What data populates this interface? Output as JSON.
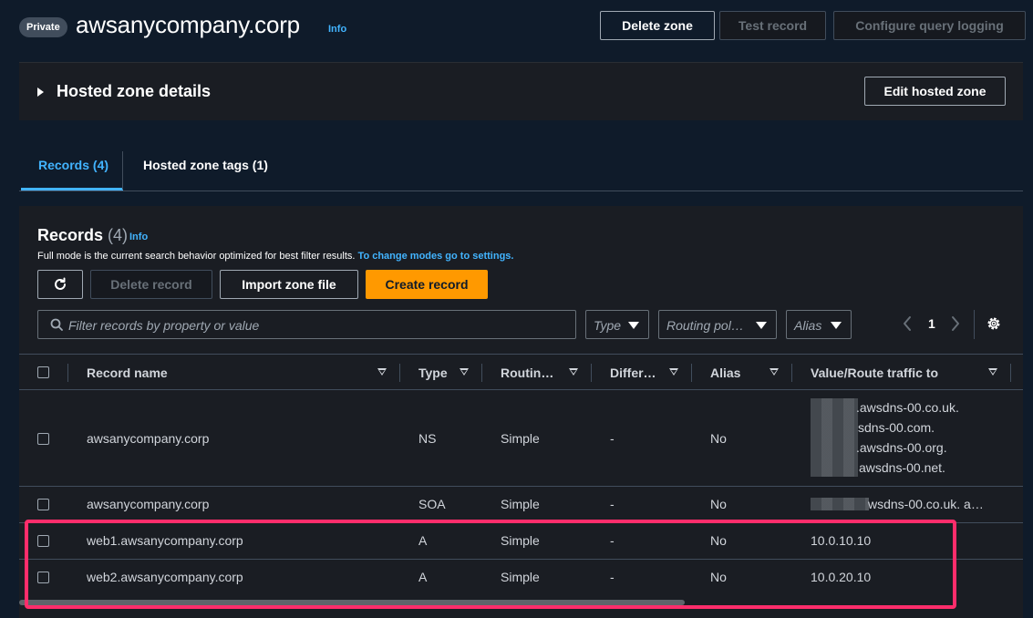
{
  "header": {
    "badge": "Private",
    "zone_name": "awsanycompany.corp",
    "info": "Info",
    "buttons": {
      "delete_zone": "Delete zone",
      "test_record": "Test record",
      "configure_logging": "Configure query logging"
    }
  },
  "details": {
    "title": "Hosted zone details",
    "edit_button": "Edit hosted zone"
  },
  "tabs": [
    {
      "label": "Records (4)",
      "active": true
    },
    {
      "label": "Hosted zone tags (1)",
      "active": false
    }
  ],
  "records": {
    "title": "Records",
    "count": "(4)",
    "info": "Info",
    "description": "Full mode is the current search behavior optimized for best filter results.",
    "description_link": "To change modes go to settings.",
    "buttons": {
      "delete_record": "Delete record",
      "import_zone": "Import zone file",
      "create_record": "Create record"
    },
    "search_placeholder": "Filter records by property or value",
    "filters": {
      "type": "Type",
      "routing": "Routing pol…",
      "alias": "Alias"
    },
    "page": "1",
    "columns": [
      "Record name",
      "Type",
      "Routin…",
      "Differ…",
      "Alias",
      "Value/Route traffic to"
    ],
    "rows": [
      {
        "name": "awsanycompany.corp",
        "type": "NS",
        "routing": "Simple",
        "differ": "-",
        "alias": "No",
        "values": [
          ".awsdns-00.co.uk.",
          "sdns-00.com.",
          ".awsdns-00.org.",
          "awsdns-00.net."
        ]
      },
      {
        "name": "awsanycompany.corp",
        "type": "SOA",
        "routing": "Simple",
        "differ": "-",
        "alias": "No",
        "values": [
          "wsdns-00.co.uk. a…"
        ]
      },
      {
        "name": "web1.awsanycompany.corp",
        "type": "A",
        "routing": "Simple",
        "differ": "-",
        "alias": "No",
        "values": [
          "10.0.10.10"
        ]
      },
      {
        "name": "web2.awsanycompany.corp",
        "type": "A",
        "routing": "Simple",
        "differ": "-",
        "alias": "No",
        "values": [
          "10.0.20.10"
        ]
      }
    ]
  },
  "colors": {
    "accent": "#42b4ff",
    "primary_button": "#ff9900",
    "highlight": "#ff2d6b"
  }
}
